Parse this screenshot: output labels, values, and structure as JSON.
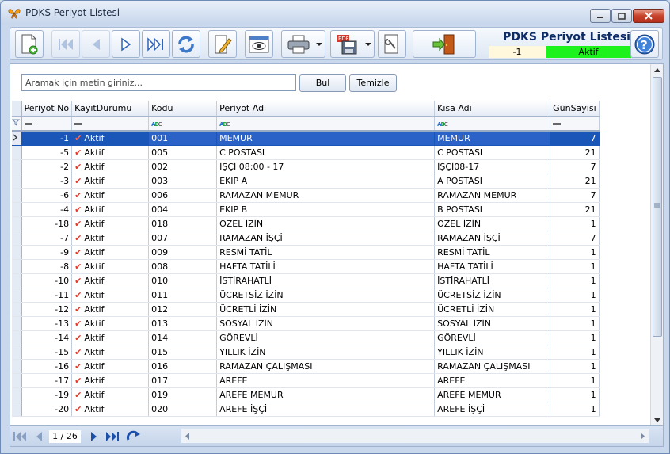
{
  "window": {
    "title": "PDKS Periyot Listesi"
  },
  "header": {
    "title": "PDKS Periyot Listesi",
    "current_id": "-1",
    "status": "Aktif"
  },
  "search": {
    "placeholder": "Aramak için metin giriniz...",
    "find_label": "Bul",
    "clear_label": "Temizle"
  },
  "columns": [
    "Periyot No",
    "KayıtDurumu",
    "Kodu",
    "Periyot Adı",
    "Kısa Adı",
    "GünSayısı"
  ],
  "rows": [
    {
      "no": "-1",
      "durum": "Aktif",
      "kodu": "001",
      "ad": "MEMUR",
      "kisa": "MEMUR",
      "gun": "7"
    },
    {
      "no": "-5",
      "durum": "Aktif",
      "kodu": "005",
      "ad": "C POSTASI",
      "kisa": "C POSTASI",
      "gun": "21"
    },
    {
      "no": "-2",
      "durum": "Aktif",
      "kodu": "002",
      "ad": "İŞÇİ 08:00 - 17",
      "kisa": "İŞÇİ08-17",
      "gun": "7"
    },
    {
      "no": "-3",
      "durum": "Aktif",
      "kodu": "003",
      "ad": "EKIP A",
      "kisa": "A POSTASI",
      "gun": "21"
    },
    {
      "no": "-6",
      "durum": "Aktif",
      "kodu": "006",
      "ad": "RAMAZAN MEMUR",
      "kisa": "RAMAZAN MEMUR",
      "gun": "7"
    },
    {
      "no": "-4",
      "durum": "Aktif",
      "kodu": "004",
      "ad": "EKIP B",
      "kisa": "B POSTASI",
      "gun": "21"
    },
    {
      "no": "-18",
      "durum": "Aktif",
      "kodu": "018",
      "ad": "ÖZEL İZİN",
      "kisa": "ÖZEL İZİN",
      "gun": "1"
    },
    {
      "no": "-7",
      "durum": "Aktif",
      "kodu": "007",
      "ad": "RAMAZAN İŞÇİ",
      "kisa": "RAMAZAN İŞÇİ",
      "gun": "7"
    },
    {
      "no": "-9",
      "durum": "Aktif",
      "kodu": "009",
      "ad": "RESMİ TATİL",
      "kisa": "RESMİ TATİL",
      "gun": "1"
    },
    {
      "no": "-8",
      "durum": "Aktif",
      "kodu": "008",
      "ad": "HAFTA TATİLİ",
      "kisa": "HAFTA TATİLİ",
      "gun": "1"
    },
    {
      "no": "-10",
      "durum": "Aktif",
      "kodu": "010",
      "ad": "İSTİRAHATLİ",
      "kisa": "İSTİRAHATLİ",
      "gun": "1"
    },
    {
      "no": "-11",
      "durum": "Aktif",
      "kodu": "011",
      "ad": "ÜCRETSİZ İZİN",
      "kisa": "ÜCRETSİZ İZİN",
      "gun": "1"
    },
    {
      "no": "-12",
      "durum": "Aktif",
      "kodu": "012",
      "ad": "ÜCRETLİ İZİN",
      "kisa": "ÜCRETLİ İZİN",
      "gun": "1"
    },
    {
      "no": "-13",
      "durum": "Aktif",
      "kodu": "013",
      "ad": "SOSYAL İZİN",
      "kisa": "SOSYAL İZİN",
      "gun": "1"
    },
    {
      "no": "-14",
      "durum": "Aktif",
      "kodu": "014",
      "ad": "GÖREVLİ",
      "kisa": "GÖREVLİ",
      "gun": "1"
    },
    {
      "no": "-15",
      "durum": "Aktif",
      "kodu": "015",
      "ad": "YILLIK İZİN",
      "kisa": "YILLIK İZİN",
      "gun": "1"
    },
    {
      "no": "-16",
      "durum": "Aktif",
      "kodu": "016",
      "ad": "RAMAZAN ÇALIŞMASI",
      "kisa": "RAMAZAN ÇALIŞMASI",
      "gun": "1"
    },
    {
      "no": "-17",
      "durum": "Aktif",
      "kodu": "017",
      "ad": "AREFE",
      "kisa": "AREFE",
      "gun": "1"
    },
    {
      "no": "-19",
      "durum": "Aktif",
      "kodu": "019",
      "ad": "AREFE MEMUR",
      "kisa": "AREFE MEMUR",
      "gun": "1"
    },
    {
      "no": "-20",
      "durum": "Aktif",
      "kodu": "020",
      "ad": "AREFE İŞÇİ",
      "kisa": "AREFE İŞÇİ",
      "gun": "1"
    }
  ],
  "pager": {
    "text": "1 / 26"
  },
  "icons": [
    "butterfly-icon",
    "new-record-icon",
    "first-icon",
    "prev-icon",
    "next-icon",
    "last-icon",
    "refresh-icon",
    "edit-icon",
    "preview-icon",
    "print-icon",
    "pdf-export-icon",
    "tools-icon",
    "exit-icon",
    "help-icon"
  ]
}
